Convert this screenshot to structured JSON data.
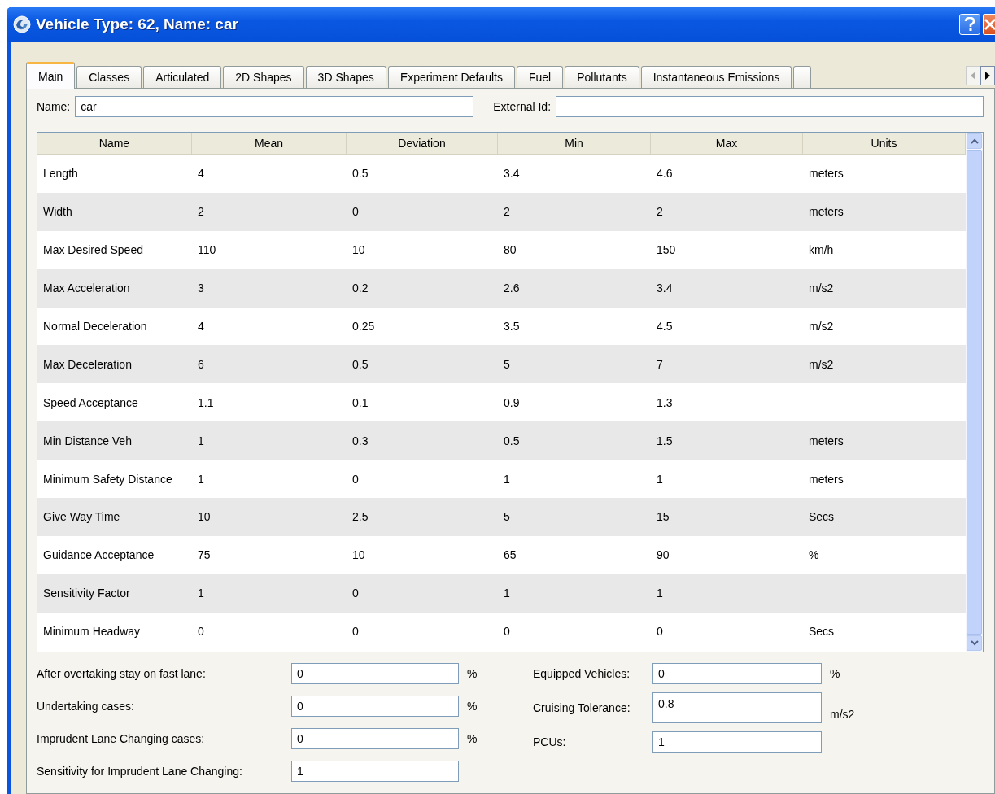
{
  "window": {
    "title": "Vehicle Type: 62, Name: car"
  },
  "tabs": [
    {
      "label": "Main",
      "selected": true
    },
    {
      "label": "Classes",
      "selected": false
    },
    {
      "label": "Articulated",
      "selected": false
    },
    {
      "label": "2D Shapes",
      "selected": false
    },
    {
      "label": "3D Shapes",
      "selected": false
    },
    {
      "label": "Experiment Defaults",
      "selected": false
    },
    {
      "label": "Fuel",
      "selected": false
    },
    {
      "label": "Pollutants",
      "selected": false
    },
    {
      "label": "Instantaneous Emissions",
      "selected": false
    }
  ],
  "name_field": {
    "label": "Name:",
    "value": "car"
  },
  "external_id_field": {
    "label": "External Id:"
  },
  "table": {
    "columns": [
      "Name",
      "Mean",
      "Deviation",
      "Min",
      "Max",
      "Units"
    ],
    "rows": [
      [
        "Length",
        "4",
        "0.5",
        "3.4",
        "4.6",
        "meters"
      ],
      [
        "Width",
        "2",
        "0",
        "2",
        "2",
        "meters"
      ],
      [
        "Max Desired Speed",
        "110",
        "10",
        "80",
        "150",
        "km/h"
      ],
      [
        "Max Acceleration",
        "3",
        "0.2",
        "2.6",
        "3.4",
        "m/s2"
      ],
      [
        "Normal Deceleration",
        "4",
        "0.25",
        "3.5",
        "4.5",
        "m/s2"
      ],
      [
        "Max Deceleration",
        "6",
        "0.5",
        "5",
        "7",
        "m/s2"
      ],
      [
        "Speed Acceptance",
        "1.1",
        "0.1",
        "0.9",
        "1.3",
        ""
      ],
      [
        "Min Distance Veh",
        "1",
        "0.3",
        "0.5",
        "1.5",
        "meters"
      ],
      [
        "Minimum Safety Distance",
        "1",
        "0",
        "1",
        "1",
        "meters"
      ],
      [
        "Give Way Time",
        "10",
        "2.5",
        "5",
        "15",
        "Secs"
      ],
      [
        "Guidance Acceptance",
        "75",
        "10",
        "65",
        "90",
        "%"
      ],
      [
        "Sensitivity Factor",
        "1",
        "0",
        "1",
        "1",
        ""
      ],
      [
        "Minimum Headway",
        "0",
        "0",
        "0",
        "0",
        "Secs"
      ]
    ]
  },
  "left_fields": [
    {
      "label": "After overtaking stay on fast lane:",
      "value": "0",
      "unit": "%"
    },
    {
      "label": "Undertaking cases:",
      "value": "0",
      "unit": "%"
    },
    {
      "label": "Imprudent Lane Changing cases:",
      "value": "0",
      "unit": "%"
    },
    {
      "label": "Sensitivity for Imprudent Lane Changing:",
      "value": "1"
    }
  ],
  "right_fields": [
    {
      "label": "Equipped Vehicles:",
      "value": "0",
      "unit": "%"
    },
    {
      "label": "Cruising Tolerance:",
      "value": "0.8",
      "unit": "m/s2",
      "kind": "tall"
    },
    {
      "label": "PCUs:",
      "value": "1"
    }
  ]
}
